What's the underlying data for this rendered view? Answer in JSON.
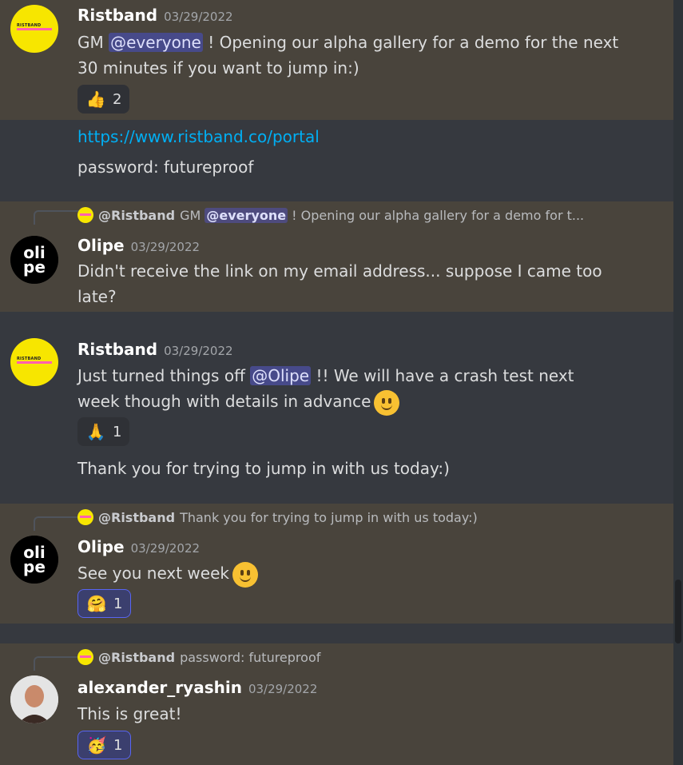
{
  "messages": [
    {
      "author": "Ristband",
      "timestamp": "03/29/2022",
      "text_before": "GM",
      "mention": "@everyone",
      "text_after": "! Opening our alpha gallery for a demo for the next",
      "text_line2": "30 minutes if you want to jump in:)",
      "reaction": {
        "emoji": "👍",
        "count": "2"
      }
    },
    {
      "link": "https://www.ristband.co/portal",
      "text": "password: futureproof"
    },
    {
      "reply": {
        "author": "@Ristband",
        "text_before": "GM",
        "mention": "@everyone",
        "text_after": "! Opening our alpha gallery for a demo for t..."
      },
      "author": "Olipe",
      "timestamp": "03/29/2022",
      "text_line1": "Didn't receive the link on my email address... suppose I came too",
      "text_line2": "late?"
    },
    {
      "author": "Ristband",
      "timestamp": "03/29/2022",
      "text_before": "Just turned things off",
      "mention": "@Olipe",
      "text_after": "!! We will have a crash test next",
      "text_line2": "week though with details in advance",
      "reaction": {
        "emoji": "🙏",
        "count": "1"
      },
      "followup": "Thank you for trying to jump in with us today:)"
    },
    {
      "reply": {
        "author": "@Ristband",
        "text": "Thank you for trying to jump in with us today:)"
      },
      "author": "Olipe",
      "timestamp": "03/29/2022",
      "text": "See you next week",
      "reaction": {
        "emoji": "🤗",
        "count": "1"
      }
    },
    {
      "reply": {
        "author": "@Ristband",
        "text": "password: futureproof"
      },
      "author": "alexander_ryashin",
      "timestamp": "03/29/2022",
      "text": "This is great!",
      "reaction": {
        "emoji": "🥳",
        "count": "1"
      }
    }
  ],
  "avatar_logo_text": "RISTBAND",
  "avatar_olipe_text": "oli pe",
  "colors": {
    "highlight": "#49443c",
    "background": "#36393f",
    "mention": "#474a8a",
    "link": "#00aff4",
    "ristband_yellow": "#f7e600"
  }
}
